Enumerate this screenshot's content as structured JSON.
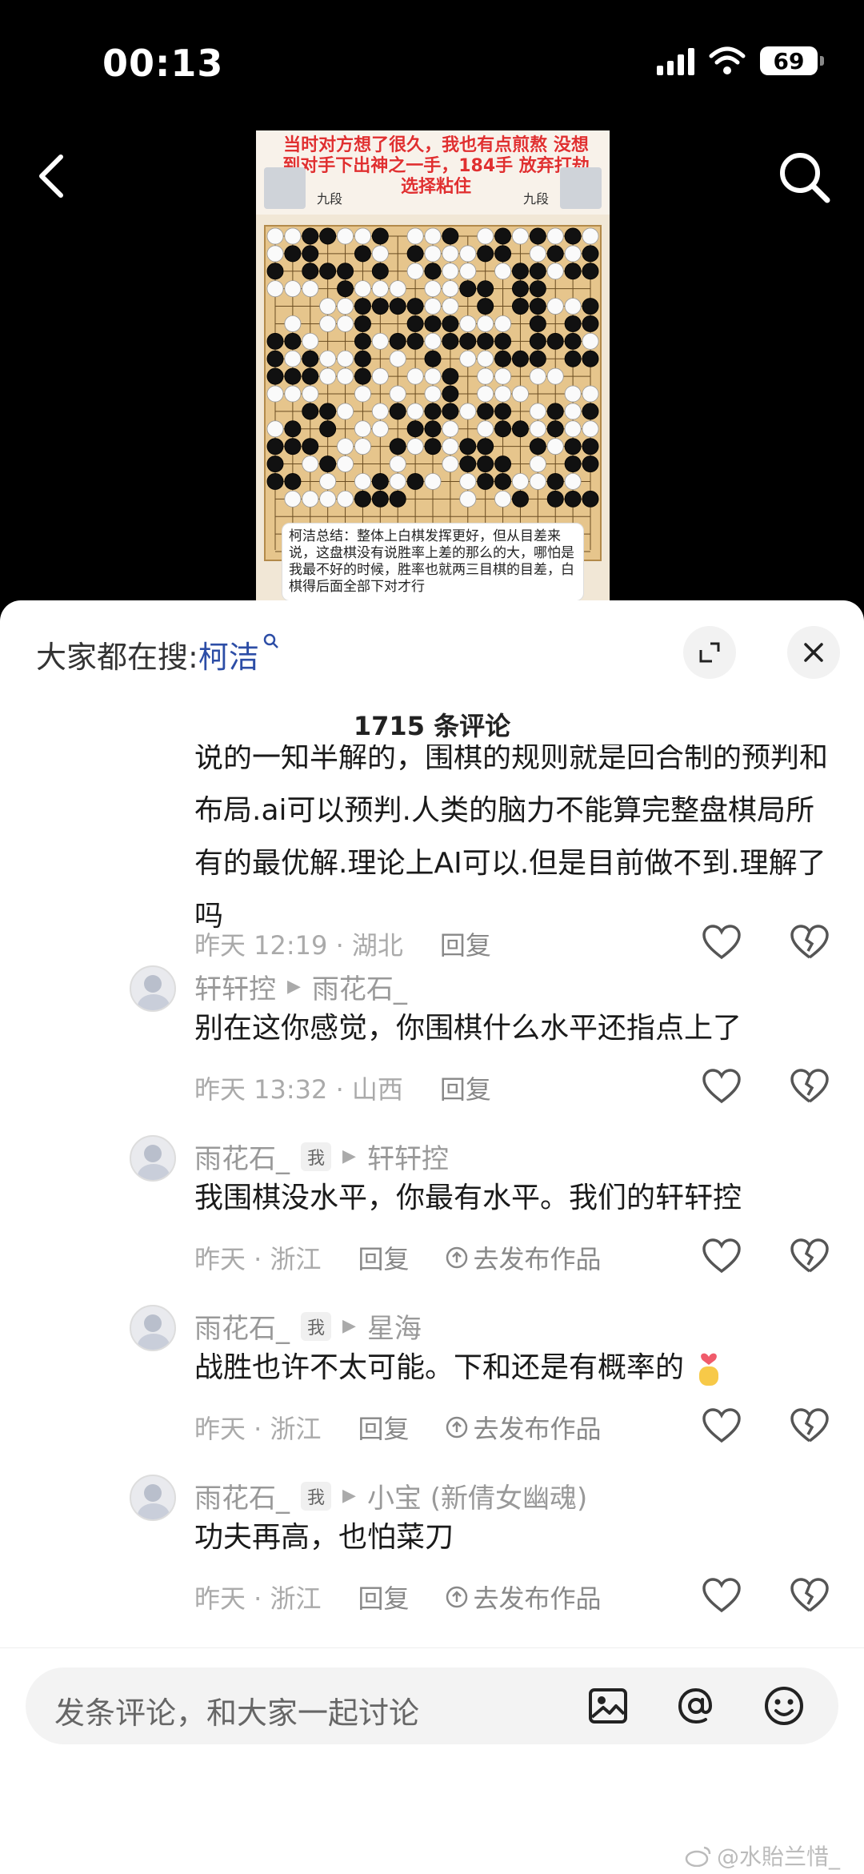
{
  "status_bar": {
    "time": "00:13",
    "battery": "69"
  },
  "video": {
    "caption": "当时对方想了很久，我也有点煎熬 没想到对手下出神之一手，184手 放弃打劫选择粘住",
    "rank_left": "九段",
    "rank_right": "九段",
    "summary": "柯洁总结：整体上白棋发挥更好，但从目差来说，这盘棋没有说胜率上差的那么的大，哪怕是我最不好的时候，胜率也就两三目棋的目差，白棋得后面全部下对才行"
  },
  "sheet": {
    "trending_label": "大家都在搜:",
    "trending_keyword": "柯洁",
    "comment_count": "1715 条评论"
  },
  "comments": [
    {
      "text": "说的一知半解的，围棋的规则就是回合制的预判和布局.ai可以预判.人类的脑力不能算完整盘棋局所有的最优解.理论上AI可以.但是目前做不到.理解了吗",
      "meta": "昨天 12:19 · 湖北",
      "reply": "回复"
    },
    {
      "author": "轩轩控",
      "reply_to": "雨花石_",
      "text": "别在这你感觉，你围棋什么水平还指点上了",
      "meta": "昨天 13:32 · 山西",
      "reply": "回复"
    },
    {
      "author": "雨花石_",
      "me_tag": "我",
      "reply_to": "轩轩控",
      "text": "我围棋没水平，你最有水平。我们的轩轩控",
      "meta": "昨天 · 浙江",
      "reply": "回复",
      "post": "去发布作品"
    },
    {
      "author": "雨花石_",
      "me_tag": "我",
      "reply_to": "星海",
      "text": "战胜也许不太可能。下和还是有概率的",
      "meta": "昨天 · 浙江",
      "reply": "回复",
      "post": "去发布作品"
    },
    {
      "author": "雨花石_",
      "me_tag": "我",
      "reply_to": "小宝 (新倩女幽魂)",
      "text": "功夫再高，也怕菜刀",
      "meta": "昨天 · 浙江",
      "reply": "回复",
      "post": "去发布作品"
    }
  ],
  "input": {
    "placeholder": "发条评论，和大家一起讨论"
  },
  "watermark": "@水貽兰惜_"
}
